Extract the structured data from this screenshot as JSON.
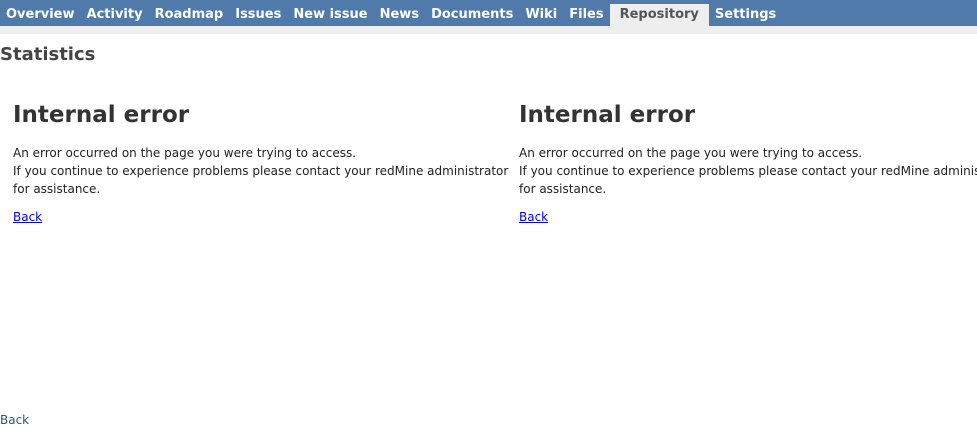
{
  "nav": {
    "tabs": [
      {
        "label": "Overview"
      },
      {
        "label": "Activity"
      },
      {
        "label": "Roadmap"
      },
      {
        "label": "Issues"
      },
      {
        "label": "New issue"
      },
      {
        "label": "News"
      },
      {
        "label": "Documents"
      },
      {
        "label": "Wiki"
      },
      {
        "label": "Files"
      },
      {
        "label": "Repository",
        "selected": true
      },
      {
        "label": "Settings"
      }
    ]
  },
  "page": {
    "title": "Statistics"
  },
  "error_panels": [
    {
      "heading": "Internal error",
      "line1": "An error occurred on the page you were trying to access.",
      "line2": "If you continue to experience problems please contact your redMine administrator",
      "line3": "for assistance.",
      "back_label": "Back"
    },
    {
      "heading": "Internal error",
      "line1": "An error occurred on the page you were trying to access.",
      "line2": "If you continue to experience problems please contact your redMine administrator",
      "line3": "for assistance.",
      "back_label": "Back"
    }
  ],
  "footer": {
    "back_label": "Back"
  },
  "colors": {
    "nav_bg": "#507aaa",
    "nav_selected_bg": "#eeeeee",
    "link": "#0000ee"
  }
}
